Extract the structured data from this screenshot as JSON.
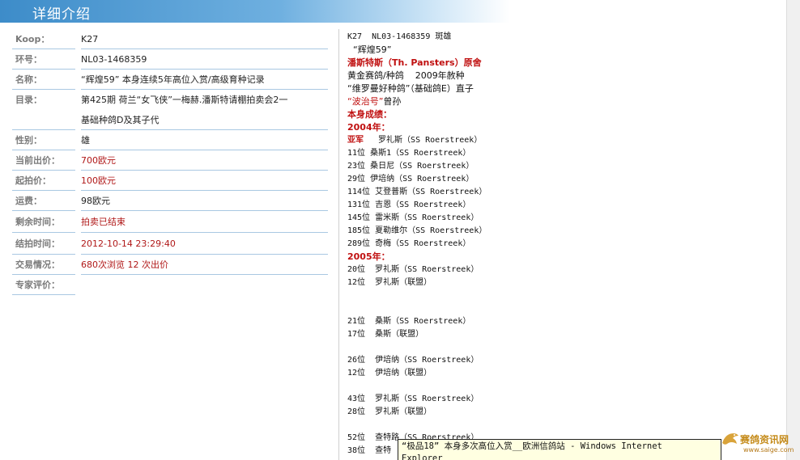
{
  "header": {
    "title": "详细介绍"
  },
  "info": {
    "koop": {
      "label": "Koop：",
      "value": "K27"
    },
    "ring": {
      "label": "环号：",
      "value": "NL03-1468359"
    },
    "name": {
      "label": "名称：",
      "value": "“辉煌59” 本身连续5年高位入赏/高级育种记录"
    },
    "catalog": {
      "label": "目录：",
      "value_line1": "第425期 荷兰“女飞侠”一梅赫.潘斯特请棚拍卖会2一",
      "value_line2": "基础种鸽D及其子代"
    },
    "sex": {
      "label": "性别：",
      "value": "雄"
    },
    "current_bid": {
      "label": "当前出价：",
      "value": "700欧元"
    },
    "start_price": {
      "label": "起拍价：",
      "value": "100欧元"
    },
    "shipping": {
      "label": "运费：",
      "value": "98欧元"
    },
    "remaining": {
      "label": "剩余时间：",
      "value": "拍卖已结束"
    },
    "end_time": {
      "label": "结拍时间：",
      "value": "2012-10-14 23:29:40"
    },
    "trade": {
      "label": "交易情况：",
      "value": "680次浏览    12 次出价"
    },
    "expert": {
      "label": "专家评价：",
      "value": ""
    }
  },
  "details": {
    "l1": "K27  NL03-1468359 斑雄",
    "l2": "  “辉煌59”",
    "l3": "潘斯特斯（Th. Pansters）原舍",
    "l4": "黄金赛鸽/种鸽    2009年赦种",
    "l5a": "“维罗曼好种鸽”（基础鸽E）直子",
    "l6a": "“波治号”",
    "l6b": "曾孙",
    "l7": "本身成绩：",
    "l8": "2004年：",
    "r2004": [
      {
        "pos": "亚军",
        "text": "   罗礼斯（SS Roerstreek）"
      },
      {
        "pos": "11位",
        "text": " 桑斯1（SS Roerstreek）"
      },
      {
        "pos": "23位",
        "text": " 桑日尼（SS Roerstreek）"
      },
      {
        "pos": "29位",
        "text": " 伊培纳（SS Roerstreek）"
      },
      {
        "pos": "114位",
        "text": " 艾登普斯（SS Roerstreek）"
      },
      {
        "pos": "131位",
        "text": " 吉恩（SS Roerstreek）"
      },
      {
        "pos": "145位",
        "text": " 雷米斯（SS Roerstreek）"
      },
      {
        "pos": "185位",
        "text": " 夏勒维尔（SS Roerstreek）"
      },
      {
        "pos": "289位",
        "text": " 奇梅（SS Roerstreek）"
      }
    ],
    "l9": "2005年：",
    "r2005a": [
      {
        "text": "20位  罗礼斯（SS Roerstreek）"
      },
      {
        "text": "12位  罗礼斯（联盟）"
      }
    ],
    "r2005b": [
      {
        "text": "21位  桑斯（SS Roerstreek）"
      },
      {
        "text": "17位  桑斯（联盟）"
      }
    ],
    "r2005c": [
      {
        "text": "26位  伊培纳（SS Roerstreek）"
      },
      {
        "text": "12位  伊培纳（联盟）"
      }
    ],
    "r2005d": [
      {
        "text": "43位  罗礼斯（SS Roerstreek）"
      },
      {
        "text": "28位  罗礼斯（联盟）"
      }
    ],
    "r2005e": [
      {
        "text": "52位  查特路（SS Roerstreek）"
      },
      {
        "text": "38位  查特"
      }
    ]
  },
  "tooltip": {
    "line1": "“极品18”  本身多次高位入赏__欧洲信鸽站 - Windows Internet",
    "line2": "Explorer"
  },
  "watermark": {
    "name": "赛鸽资讯网",
    "url": "www.saige.com",
    "icon": "pigeon-logo-icon"
  }
}
